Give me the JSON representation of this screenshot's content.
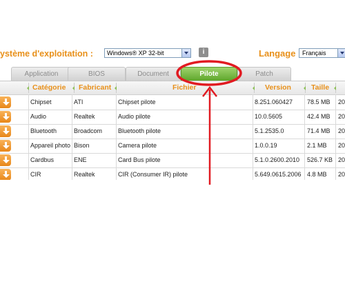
{
  "toolbar": {
    "os_label": "ystème d'exploitation :",
    "os_value": "Windows® XP 32-bit",
    "info_icon": "i",
    "lang_label": "Langage :",
    "lang_value": "Français"
  },
  "tabs": [
    {
      "label": "Application",
      "active": false
    },
    {
      "label": "BIOS",
      "active": false
    },
    {
      "label": "Document",
      "active": false
    },
    {
      "label": "Pilote",
      "active": true
    },
    {
      "label": "Patch",
      "active": false
    }
  ],
  "table": {
    "headers": [
      "Catégorie",
      "Fabricant",
      "Fichier",
      "Version",
      "Taille"
    ],
    "rows": [
      {
        "cat": "Chipset",
        "maker": "ATI",
        "file": "Chipset pilote",
        "version": "8.251.060427",
        "size": "78.5 MB",
        "date": "20"
      },
      {
        "cat": "Audio",
        "maker": "Realtek",
        "file": "Audio pilote",
        "version": "10.0.5605",
        "size": "42.4 MB",
        "date": "20"
      },
      {
        "cat": "Bluetooth",
        "maker": "Broadcom",
        "file": "Bluetooth pilote",
        "version": "5.1.2535.0",
        "size": "71.4 MB",
        "date": "20"
      },
      {
        "cat": "Appareil photo",
        "maker": "Bison",
        "file": "Camera pilote",
        "version": "1.0.0.19",
        "size": "2.1 MB",
        "date": "20"
      },
      {
        "cat": "Cardbus",
        "maker": "ENE",
        "file": "Card Bus pilote",
        "version": "5.1.0.2600.2010",
        "size": "526.7 KB",
        "date": "20"
      },
      {
        "cat": "CIR",
        "maker": "Realtek",
        "file": "CIR (Consumer IR) pilote",
        "version": "5.649.0615.2006",
        "size": "4.8 MB",
        "date": "20"
      }
    ]
  },
  "colors": {
    "accent_orange": "#e8901a",
    "tab_active_green": "#6bb33a",
    "annotation_red": "#e11b22"
  }
}
